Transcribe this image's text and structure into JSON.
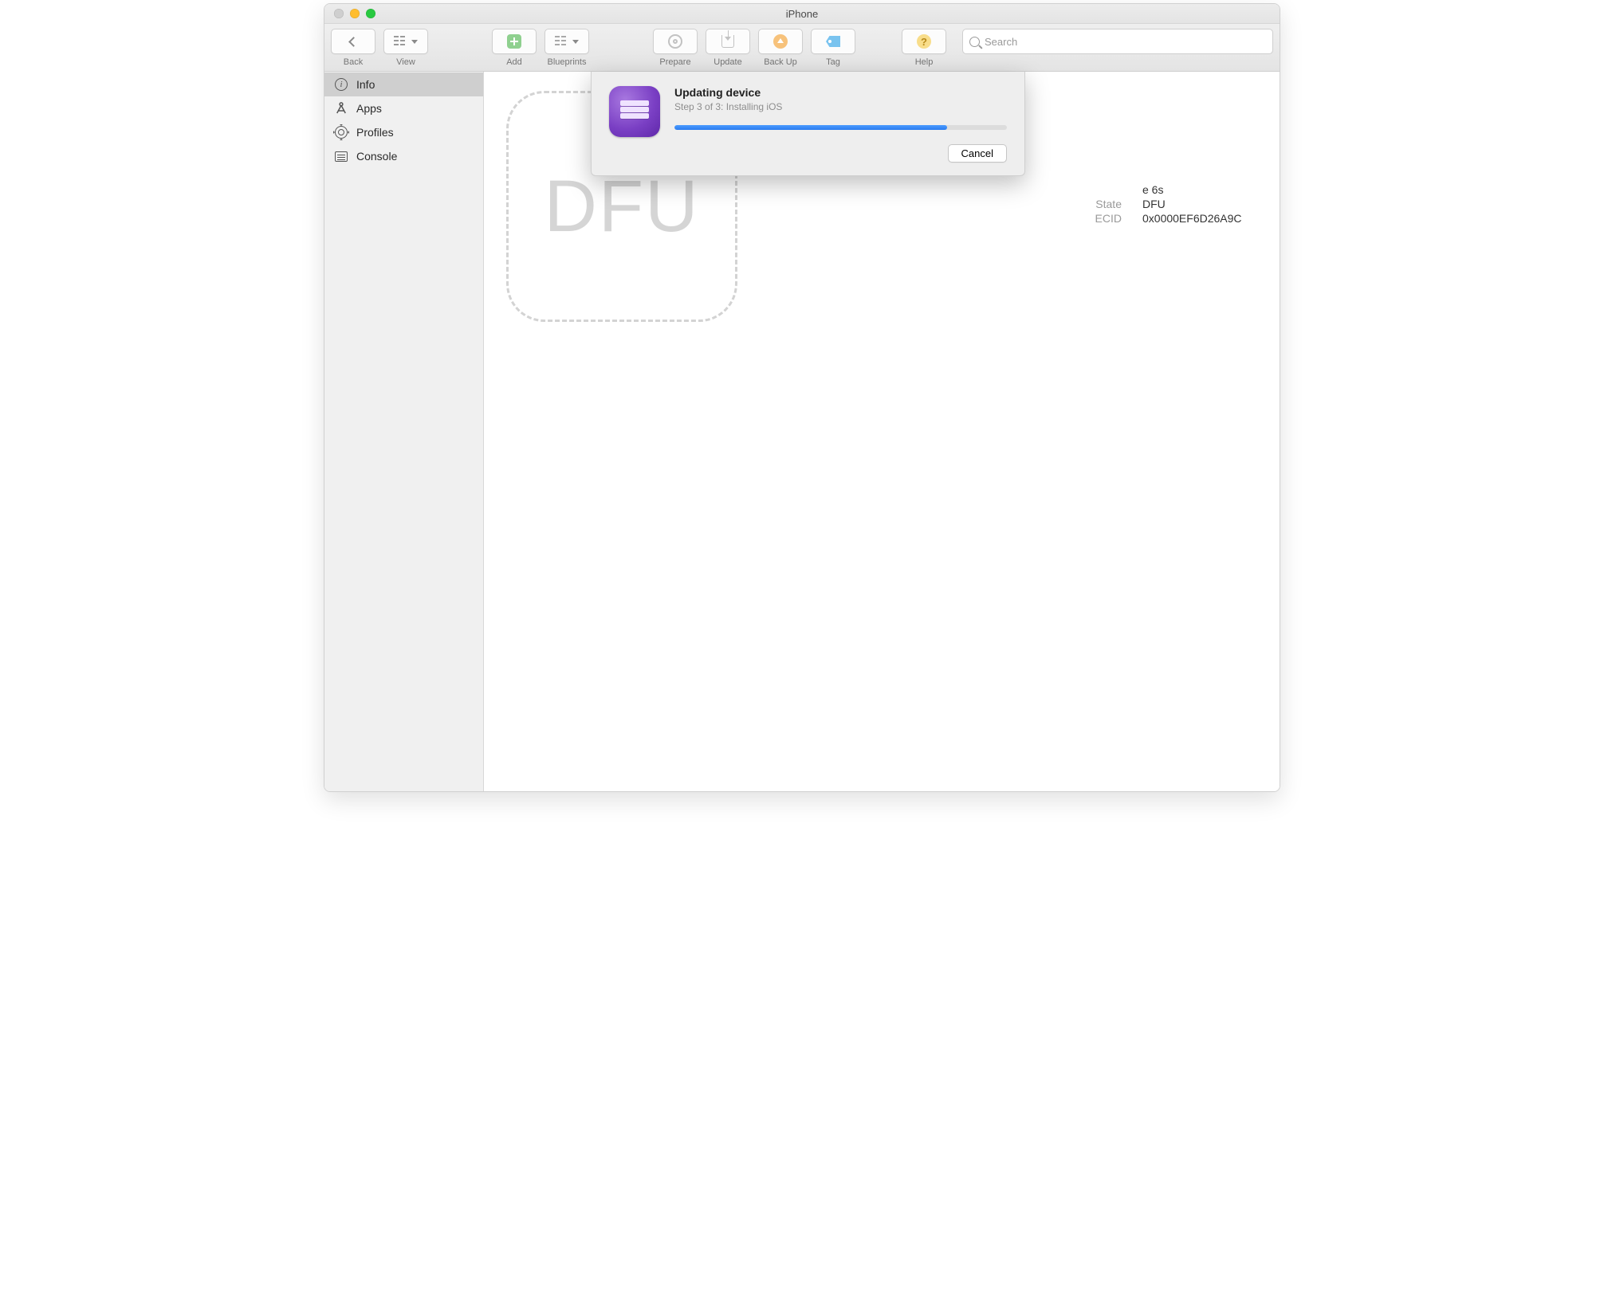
{
  "window": {
    "title": "iPhone"
  },
  "toolbar": {
    "back": "Back",
    "view": "View",
    "add": "Add",
    "blueprints": "Blueprints",
    "prepare": "Prepare",
    "update": "Update",
    "backup": "Back Up",
    "tag": "Tag",
    "help": "Help",
    "search_placeholder": "Search"
  },
  "sidebar": {
    "items": [
      {
        "label": "Info",
        "selected": true
      },
      {
        "label": "Apps",
        "selected": false
      },
      {
        "label": "Profiles",
        "selected": false
      },
      {
        "label": "Console",
        "selected": false
      }
    ]
  },
  "device": {
    "thumbnail_text": "DFU",
    "model_fragment": "e 6s",
    "state_label": "State",
    "state_value": "DFU",
    "ecid_label": "ECID",
    "ecid_value": "0x0000EF6D26A9C"
  },
  "dialog": {
    "title": "Updating device",
    "subtitle": "Step 3 of 3: Installing iOS",
    "progress_percent": 82,
    "cancel": "Cancel"
  }
}
